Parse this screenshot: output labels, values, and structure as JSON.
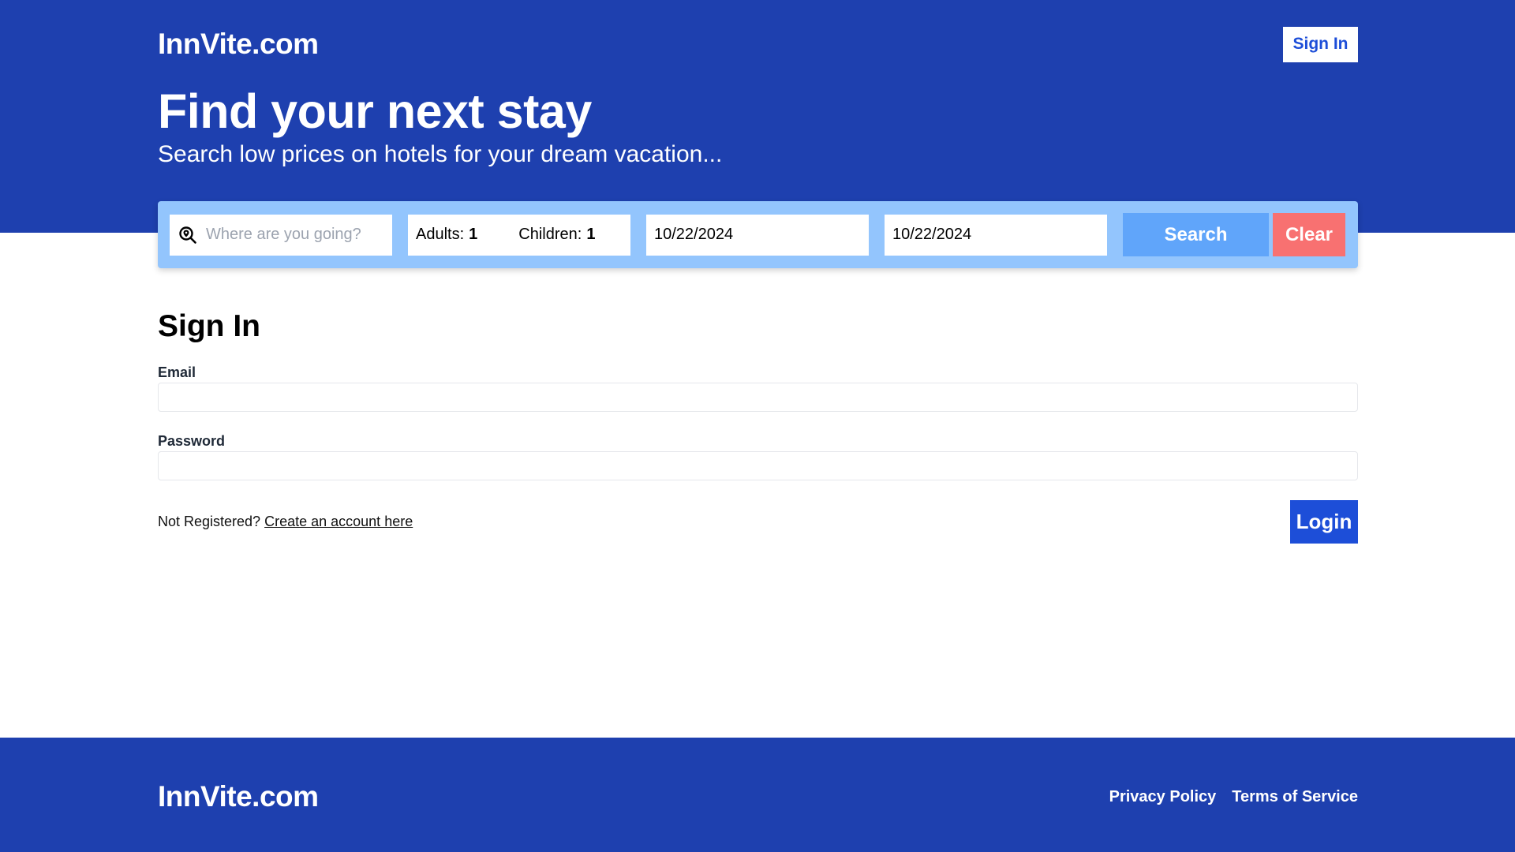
{
  "header": {
    "logo": "InnVite.com",
    "sign_in_label": "Sign In",
    "headline": "Find your next stay",
    "subheadline": "Search low prices on hotels for your dream vacation..."
  },
  "search": {
    "destination_placeholder": "Where are you going?",
    "destination_icon": "map-search-icon",
    "adults_label": "Adults:",
    "adults_value": "1",
    "children_label": "Children:",
    "children_value": "1",
    "check_in": "10/22/2024",
    "check_out": "10/22/2024",
    "search_label": "Search",
    "clear_label": "Clear"
  },
  "form": {
    "title": "Sign In",
    "email_label": "Email",
    "email_value": "",
    "password_label": "Password",
    "password_value": "",
    "not_registered_text": "Not Registered?",
    "create_account_link": "Create an account here",
    "login_label": "Login"
  },
  "footer": {
    "logo": "InnVite.com",
    "links": [
      "Privacy Policy",
      "Terms of Service"
    ]
  },
  "colors": {
    "brand_blue": "#1e40af",
    "search_bar_bg": "#93c5fd",
    "search_button": "#60a5fa",
    "clear_button": "#f87171",
    "login_button": "#1d4ed8"
  }
}
